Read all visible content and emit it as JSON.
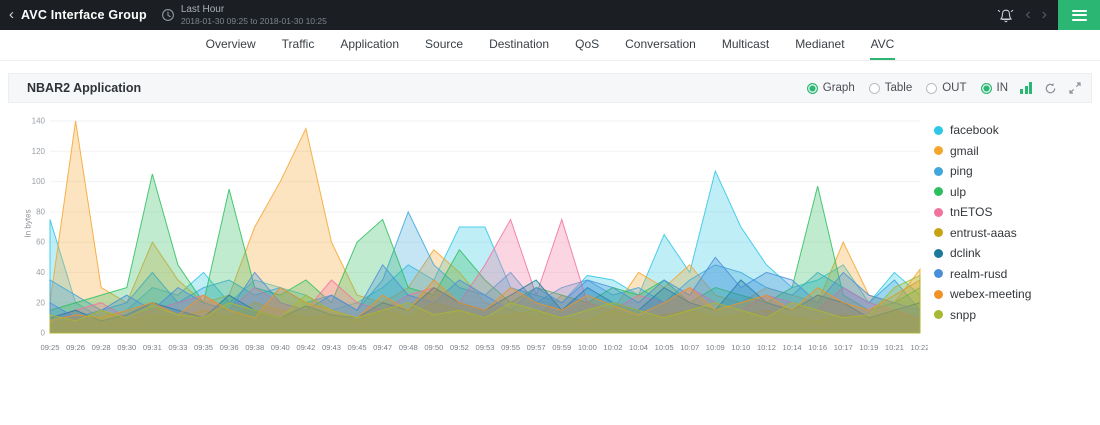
{
  "topbar": {
    "title": "AVC Interface Group",
    "time_label": "Last Hour",
    "time_range": "2018-01-30 09:25 to 2018-01-30 10:25"
  },
  "nav": {
    "tabs": [
      "Overview",
      "Traffic",
      "Application",
      "Source",
      "Destination",
      "QoS",
      "Conversation",
      "Multicast",
      "Medianet",
      "AVC"
    ],
    "active_tab": "AVC"
  },
  "panel": {
    "title": "NBAR2 Application",
    "toggles": [
      {
        "label": "Graph",
        "selected": true
      },
      {
        "label": "Table",
        "selected": false
      },
      {
        "label": "OUT",
        "selected": false
      },
      {
        "label": "IN",
        "selected": true
      }
    ]
  },
  "icons": {
    "back": "chevron-left",
    "clock": "clock",
    "alarm": "alarm-bell",
    "prev": "chevron-left",
    "next": "chevron-right",
    "menu": "hamburger-menu",
    "chart_type": "bar-chart",
    "refresh": "refresh",
    "expand": "expand"
  },
  "colors": {
    "accent_green": "#2bb673",
    "topbar_bg": "#1b1e23"
  },
  "chart_data": {
    "type": "area",
    "title": "NBAR2 Application",
    "xlabel": "",
    "ylabel": "In bytes",
    "ylim": [
      0,
      140
    ],
    "y_tick_step": 20,
    "grid": true,
    "legend_position": "right",
    "categories": [
      "09:25",
      "09:26",
      "09:28",
      "09:30",
      "09:31",
      "09:33",
      "09:35",
      "09:36",
      "09:38",
      "09:40",
      "09:42",
      "09:43",
      "09:45",
      "09:47",
      "09:48",
      "09:50",
      "09:52",
      "09:53",
      "09:55",
      "09:57",
      "09:59",
      "10:00",
      "10:02",
      "10:04",
      "10:05",
      "10:07",
      "10:09",
      "10:10",
      "10:12",
      "10:14",
      "10:16",
      "10:17",
      "10:19",
      "10:21",
      "10:22"
    ],
    "series": [
      {
        "name": "facebook",
        "color": "#2ec7e6",
        "values": [
          75,
          20,
          10,
          15,
          30,
          25,
          40,
          20,
          35,
          30,
          25,
          15,
          20,
          30,
          45,
          35,
          70,
          70,
          30,
          25,
          20,
          38,
          35,
          25,
          65,
          40,
          107,
          70,
          45,
          30,
          35,
          45,
          20,
          40,
          25
        ]
      },
      {
        "name": "gmail",
        "color": "#f5a62e",
        "values": [
          20,
          140,
          30,
          20,
          60,
          35,
          20,
          25,
          70,
          100,
          135,
          60,
          25,
          20,
          30,
          55,
          40,
          20,
          15,
          10,
          25,
          20,
          15,
          40,
          30,
          45,
          25,
          20,
          30,
          25,
          20,
          60,
          25,
          20,
          42
        ]
      },
      {
        "name": "ping",
        "color": "#3fa7dc",
        "values": [
          35,
          25,
          15,
          20,
          40,
          20,
          30,
          35,
          25,
          30,
          20,
          25,
          15,
          35,
          80,
          45,
          30,
          25,
          40,
          20,
          30,
          35,
          25,
          30,
          20,
          35,
          45,
          40,
          30,
          25,
          40,
          30,
          20,
          35,
          15
        ]
      },
      {
        "name": "ulp",
        "color": "#2dbe60",
        "values": [
          15,
          20,
          25,
          30,
          105,
          45,
          20,
          95,
          30,
          25,
          35,
          20,
          60,
          75,
          30,
          25,
          55,
          35,
          20,
          30,
          25,
          20,
          30,
          25,
          35,
          20,
          30,
          25,
          20,
          30,
          97,
          25,
          15,
          20,
          30
        ]
      },
      {
        "name": "tnETOS",
        "color": "#f2739f",
        "values": [
          10,
          15,
          20,
          10,
          15,
          20,
          25,
          15,
          30,
          20,
          15,
          35,
          20,
          15,
          25,
          30,
          20,
          45,
          75,
          25,
          75,
          20,
          15,
          25,
          20,
          30,
          20,
          15,
          25,
          20,
          15,
          30,
          20,
          15,
          10
        ]
      },
      {
        "name": "entrust-aaas",
        "color": "#c8a415",
        "values": [
          5,
          10,
          15,
          8,
          12,
          10,
          15,
          10,
          20,
          15,
          10,
          12,
          8,
          15,
          10,
          20,
          15,
          10,
          12,
          15,
          10,
          8,
          15,
          10,
          12,
          15,
          10,
          12,
          15,
          10,
          8,
          12,
          10,
          15,
          8
        ]
      },
      {
        "name": "dclink",
        "color": "#1b7a99",
        "values": [
          10,
          15,
          8,
          12,
          20,
          15,
          10,
          25,
          15,
          10,
          18,
          12,
          10,
          20,
          15,
          30,
          20,
          15,
          25,
          35,
          15,
          30,
          20,
          15,
          30,
          20,
          15,
          35,
          20,
          15,
          25,
          20,
          10,
          15,
          20
        ]
      },
      {
        "name": "realm-rusd",
        "color": "#4a90d9",
        "values": [
          20,
          10,
          15,
          25,
          15,
          30,
          20,
          15,
          40,
          20,
          15,
          25,
          15,
          45,
          25,
          20,
          35,
          25,
          15,
          30,
          20,
          35,
          30,
          20,
          35,
          25,
          50,
          30,
          40,
          35,
          20,
          40,
          25,
          20,
          15
        ]
      },
      {
        "name": "webex-meeting",
        "color": "#ef9326",
        "values": [
          8,
          12,
          10,
          15,
          20,
          12,
          25,
          15,
          10,
          30,
          20,
          15,
          10,
          25,
          15,
          35,
          20,
          15,
          30,
          20,
          15,
          25,
          18,
          12,
          20,
          30,
          15,
          20,
          25,
          15,
          30,
          20,
          15,
          25,
          35
        ]
      },
      {
        "name": "snpp",
        "color": "#a8b832",
        "values": [
          12,
          8,
          15,
          10,
          18,
          12,
          10,
          20,
          15,
          10,
          25,
          15,
          10,
          15,
          20,
          12,
          15,
          10,
          20,
          15,
          10,
          15,
          20,
          15,
          10,
          15,
          20,
          15,
          10,
          20,
          15,
          10,
          12,
          30,
          38
        ]
      }
    ]
  }
}
